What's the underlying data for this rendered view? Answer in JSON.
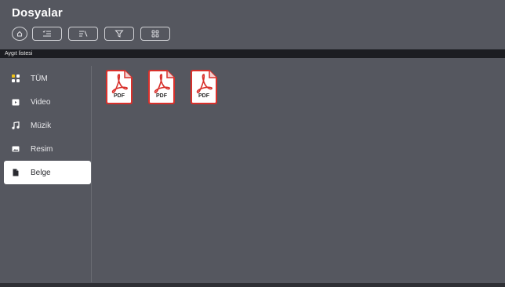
{
  "header": {
    "title": "Dosyalar"
  },
  "toolbar": {
    "buttons": [
      {
        "icon": "home-icon"
      },
      {
        "icon": "list-select-icon"
      },
      {
        "icon": "sort-icon"
      },
      {
        "icon": "filter-icon"
      },
      {
        "icon": "grid-view-icon"
      }
    ]
  },
  "device_bar": {
    "label": "Aygıt listesi"
  },
  "sidebar": {
    "items": [
      {
        "label": "TÜM",
        "icon": "all-grid-icon",
        "active": false
      },
      {
        "label": "Video",
        "icon": "video-icon",
        "active": false
      },
      {
        "label": "Müzik",
        "icon": "music-icon",
        "active": false
      },
      {
        "label": "Resim",
        "icon": "image-icon",
        "active": false
      },
      {
        "label": "Belge",
        "icon": "document-icon",
        "active": true
      }
    ]
  },
  "files": [
    {
      "type": "PDF",
      "icon": "pdf-file-icon"
    },
    {
      "type": "PDF",
      "icon": "pdf-file-icon"
    },
    {
      "type": "PDF",
      "icon": "pdf-file-icon"
    }
  ],
  "colors": {
    "background": "#55575f",
    "devbar": "#1c1d22",
    "pdf_red": "#d8302b",
    "active_item": "#ffffff"
  }
}
